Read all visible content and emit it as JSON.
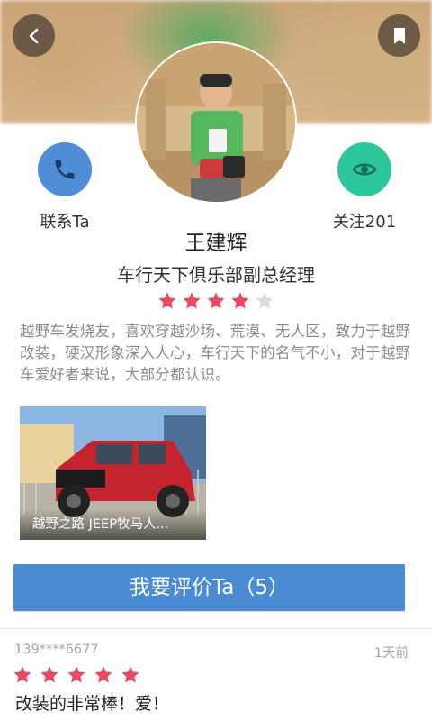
{
  "profile": {
    "name": "王建辉",
    "title": "车行天下俱乐部副总经理",
    "rating": 4,
    "rating_max": 5,
    "bio": "越野车发烧友，喜欢穿越沙场、荒漠、无人区，致力于越野改装，硬汉形象深入人心，车行天下的名气不小，对于越野车爱好者来说，大部分都认识。"
  },
  "actions": {
    "contact_label": "联系Ta",
    "follow_label": "关注201"
  },
  "card": {
    "caption": "越野之路 JEEP牧马人..."
  },
  "rate_button": {
    "label": "我要评价Ta（5）"
  },
  "reviews": [
    {
      "user": "139****6677",
      "time": "1天前",
      "stars": 5,
      "text": "改装的非常棒！爱！"
    }
  ],
  "colors": {
    "accent_blue": "#4a8bd3",
    "follow_green": "#2cc79b",
    "star_active": "#e94a5f",
    "star_inactive": "#dddddd"
  },
  "icons": {
    "back": "chevron-left-icon",
    "bookmark": "bookmark-icon",
    "phone": "phone-icon",
    "eye": "eye-icon",
    "star": "star-icon"
  }
}
